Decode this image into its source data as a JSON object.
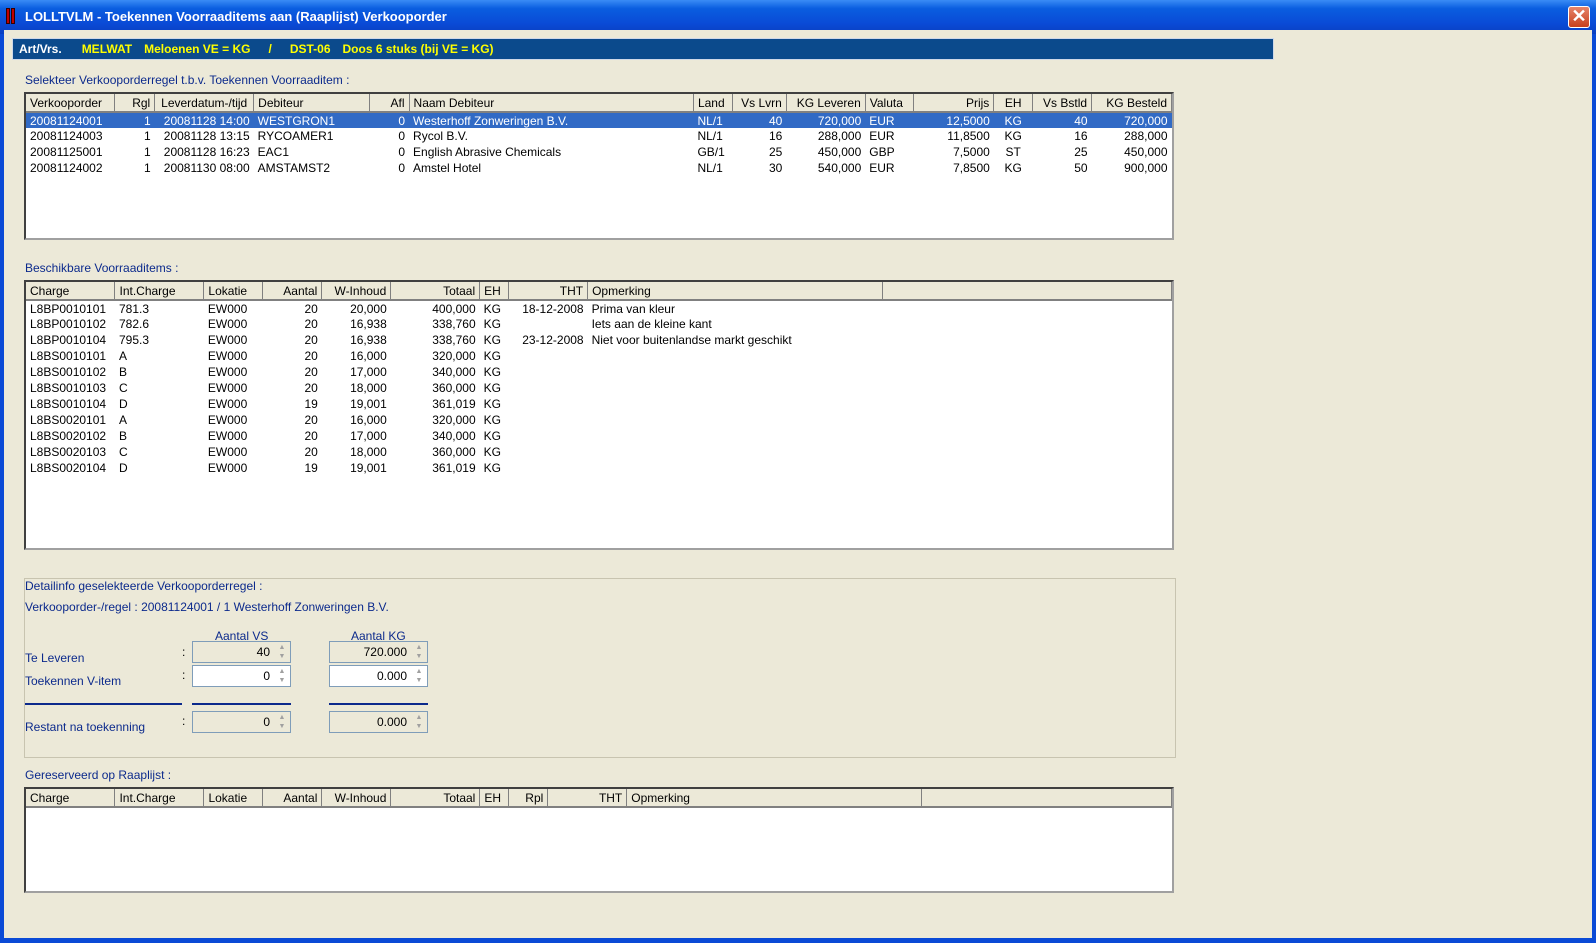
{
  "window": {
    "title": "LOLLTVLM - Toekennen Voorraaditems aan (Raaplijst) Verkooporder",
    "close_glyph": "✕"
  },
  "artbar": {
    "label": "Art/Vrs.",
    "art_code": "MELWAT",
    "art_desc": "Meloenen VE = KG",
    "sep": "/",
    "vrs_code": "DST-06",
    "vrs_desc": "Doos 6 stuks (bij VE  =  KG)"
  },
  "orders": {
    "label": "Selekteer Verkooporderregel t.b.v. Toekennen Voorraaditem :",
    "columns": [
      "Verkooporder",
      "Rgl",
      "Leverdatum-/tijd",
      "Debiteur",
      "Afl",
      "Naam Debiteur",
      "Land",
      "Vs Lvrn",
      "KG Leveren",
      "Valuta",
      "Prijs",
      "EH",
      "Vs Bstld",
      "KG Besteld"
    ],
    "rows": [
      [
        "20081124001",
        "1",
        "20081128 14:00",
        "WESTGRON1",
        "0",
        "Westerhoff Zonweringen B.V.",
        "NL/1",
        "40",
        "720,000",
        "EUR",
        "12,5000",
        "KG",
        "40",
        "720,000"
      ],
      [
        "20081124003",
        "1",
        "20081128 13:15",
        "RYCOAMER1",
        "0",
        "Rycol B.V.",
        "NL/1",
        "16",
        "288,000",
        "EUR",
        "11,8500",
        "KG",
        "16",
        "288,000"
      ],
      [
        "20081125001",
        "1",
        "20081128 16:23",
        "EAC1",
        "0",
        "English Abrasive Chemicals",
        "GB/1",
        "25",
        "450,000",
        "GBP",
        "7,5000",
        "ST",
        "25",
        "450,000"
      ],
      [
        "20081124002",
        "1",
        "20081130 08:00",
        "AMSTAMST2",
        "0",
        "Amstel Hotel",
        "NL/1",
        "30",
        "540,000",
        "EUR",
        "7,8500",
        "KG",
        "50",
        "900,000"
      ]
    ]
  },
  "stock": {
    "label": "Beschikbare Voorraaditems :",
    "columns": [
      "Charge",
      "Int.Charge",
      "Lokatie",
      "Aantal",
      "W-Inhoud",
      "Totaal",
      "EH",
      "THT",
      "Opmerking",
      ""
    ],
    "rows": [
      [
        "L8BP0010101",
        "781.3",
        "EW000",
        "20",
        "20,000",
        "400,000",
        "KG",
        "18-12-2008",
        "Prima van kleur"
      ],
      [
        "L8BP0010102",
        "782.6",
        "EW000",
        "20",
        "16,938",
        "338,760",
        "KG",
        "",
        "Iets aan de kleine kant"
      ],
      [
        "L8BP0010104",
        "795.3",
        "EW000",
        "20",
        "16,938",
        "338,760",
        "KG",
        "23-12-2008",
        "Niet voor buitenlandse markt geschikt"
      ],
      [
        "L8BS0010101",
        "A",
        "EW000",
        "20",
        "16,000",
        "320,000",
        "KG",
        "",
        ""
      ],
      [
        "L8BS0010102",
        "B",
        "EW000",
        "20",
        "17,000",
        "340,000",
        "KG",
        "",
        ""
      ],
      [
        "L8BS0010103",
        "C",
        "EW000",
        "20",
        "18,000",
        "360,000",
        "KG",
        "",
        ""
      ],
      [
        "L8BS0010104",
        "D",
        "EW000",
        "19",
        "19,001",
        "361,019",
        "KG",
        "",
        ""
      ],
      [
        "L8BS0020101",
        "A",
        "EW000",
        "20",
        "16,000",
        "320,000",
        "KG",
        "",
        ""
      ],
      [
        "L8BS0020102",
        "B",
        "EW000",
        "20",
        "17,000",
        "340,000",
        "KG",
        "",
        ""
      ],
      [
        "L8BS0020103",
        "C",
        "EW000",
        "20",
        "18,000",
        "360,000",
        "KG",
        "",
        ""
      ],
      [
        "L8BS0020104",
        "D",
        "EW000",
        "19",
        "19,001",
        "361,019",
        "KG",
        "",
        ""
      ]
    ]
  },
  "detail": {
    "label": "Detailinfo geselekteerde Verkooporderregel :",
    "order_line": "Verkooporder-/regel : 20081124001 / 1     Westerhoff Zonweringen B.V.",
    "col_vs": "Aantal VS",
    "col_kg": "Aantal KG",
    "te_leveren_label": "Te Leveren",
    "toekennen_label": "Toekennen V-item",
    "restant_label": "Restant na toekenning",
    "colon": ":",
    "te_leveren_vs": "40",
    "te_leveren_kg": "720.000",
    "toekennen_vs": "0",
    "toekennen_kg": "0.000",
    "restant_vs": "0",
    "restant_kg": "0.000"
  },
  "reserved": {
    "label": "Gereserveerd op Raaplijst :",
    "columns": [
      "Charge",
      "Int.Charge",
      "Lokatie",
      "Aantal",
      "W-Inhoud",
      "Totaal",
      "EH",
      "Rpl",
      "THT",
      "Opmerking",
      ""
    ]
  }
}
